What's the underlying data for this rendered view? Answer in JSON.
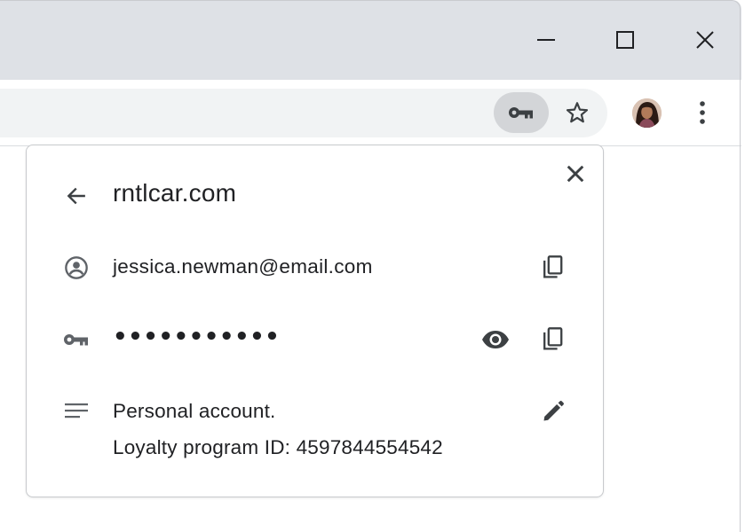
{
  "browser": {
    "title_bar_color": "#dee1e6",
    "controls": [
      "minimize-icon",
      "maximize-icon",
      "close-icon"
    ],
    "toolbar": {
      "omnibox_color": "#f1f3f4",
      "key_chip_icon": "key-icon",
      "bookmark_icon": "star-outline-icon",
      "menu_icon": "more-vert-icon"
    }
  },
  "password_bubble": {
    "site": "rntlcar.com",
    "username": "jessica.newman@email.com",
    "password_masked": "•••••••••••",
    "note_line1": "Personal account.",
    "note_line2": "Loyalty program ID: 4597844554542",
    "icons": {
      "back": "arrow-back-icon",
      "close": "close-icon",
      "user": "account-circle-icon",
      "password": "key-icon",
      "note": "notes-icon",
      "copy": "copy-icon",
      "reveal": "eye-icon",
      "edit": "pencil-icon"
    }
  }
}
